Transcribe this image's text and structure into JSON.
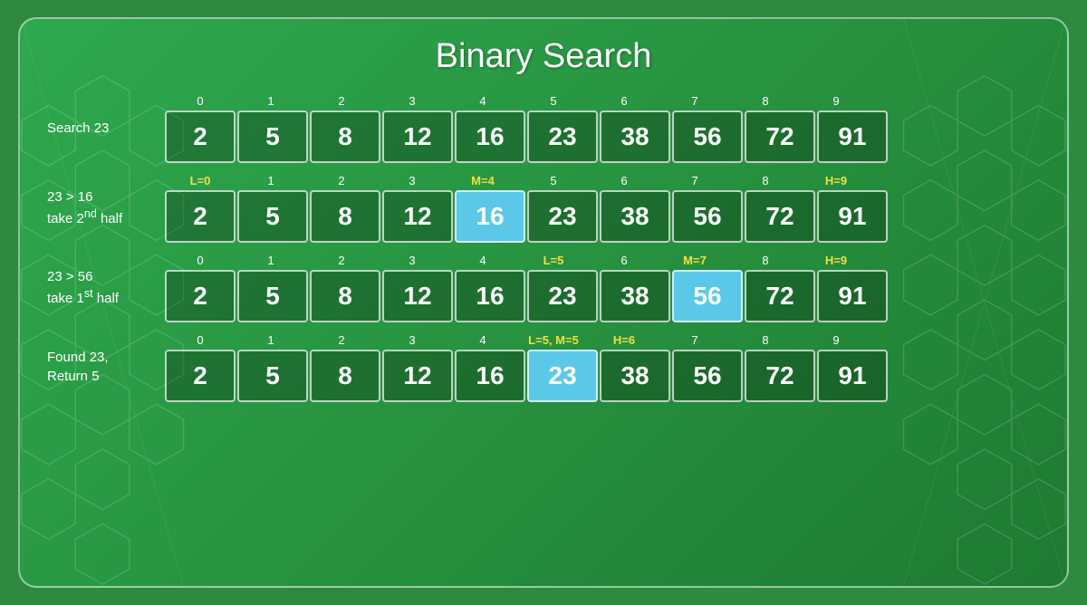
{
  "title": "Binary Search",
  "rows": [
    {
      "label": "Search 23",
      "indices": [
        {
          "val": "0",
          "style": "normal"
        },
        {
          "val": "1",
          "style": "normal"
        },
        {
          "val": "2",
          "style": "normal"
        },
        {
          "val": "3",
          "style": "normal"
        },
        {
          "val": "4",
          "style": "normal"
        },
        {
          "val": "5",
          "style": "normal"
        },
        {
          "val": "6",
          "style": "normal"
        },
        {
          "val": "7",
          "style": "normal"
        },
        {
          "val": "8",
          "style": "normal"
        },
        {
          "val": "9",
          "style": "normal"
        }
      ],
      "cells": [
        {
          "val": "2",
          "style": "normal"
        },
        {
          "val": "5",
          "style": "normal"
        },
        {
          "val": "8",
          "style": "normal"
        },
        {
          "val": "12",
          "style": "normal"
        },
        {
          "val": "16",
          "style": "normal"
        },
        {
          "val": "23",
          "style": "normal"
        },
        {
          "val": "38",
          "style": "normal"
        },
        {
          "val": "56",
          "style": "normal"
        },
        {
          "val": "72",
          "style": "normal"
        },
        {
          "val": "91",
          "style": "normal"
        }
      ]
    },
    {
      "label": "23 > 16\ntake 2nd half",
      "label2": "nd",
      "indices": [
        {
          "val": "L=0",
          "style": "yellow"
        },
        {
          "val": "1",
          "style": "normal"
        },
        {
          "val": "2",
          "style": "normal"
        },
        {
          "val": "3",
          "style": "normal"
        },
        {
          "val": "M=4",
          "style": "yellow"
        },
        {
          "val": "5",
          "style": "normal"
        },
        {
          "val": "6",
          "style": "normal"
        },
        {
          "val": "7",
          "style": "normal"
        },
        {
          "val": "8",
          "style": "normal"
        },
        {
          "val": "H=9",
          "style": "yellow"
        }
      ],
      "cells": [
        {
          "val": "2",
          "style": "normal"
        },
        {
          "val": "5",
          "style": "normal"
        },
        {
          "val": "8",
          "style": "normal"
        },
        {
          "val": "12",
          "style": "normal"
        },
        {
          "val": "16",
          "style": "highlighted"
        },
        {
          "val": "23",
          "style": "normal"
        },
        {
          "val": "38",
          "style": "normal"
        },
        {
          "val": "56",
          "style": "normal"
        },
        {
          "val": "72",
          "style": "normal"
        },
        {
          "val": "91",
          "style": "normal"
        }
      ]
    },
    {
      "label": "23 > 56\ntake 1st half",
      "indices": [
        {
          "val": "0",
          "style": "normal"
        },
        {
          "val": "1",
          "style": "normal"
        },
        {
          "val": "2",
          "style": "normal"
        },
        {
          "val": "3",
          "style": "normal"
        },
        {
          "val": "4",
          "style": "normal"
        },
        {
          "val": "L=5",
          "style": "yellow"
        },
        {
          "val": "6",
          "style": "normal"
        },
        {
          "val": "M=7",
          "style": "yellow"
        },
        {
          "val": "8",
          "style": "normal"
        },
        {
          "val": "H=9",
          "style": "yellow"
        }
      ],
      "cells": [
        {
          "val": "2",
          "style": "normal"
        },
        {
          "val": "5",
          "style": "normal"
        },
        {
          "val": "8",
          "style": "normal"
        },
        {
          "val": "12",
          "style": "normal"
        },
        {
          "val": "16",
          "style": "normal"
        },
        {
          "val": "23",
          "style": "normal"
        },
        {
          "val": "38",
          "style": "normal"
        },
        {
          "val": "56",
          "style": "highlighted"
        },
        {
          "val": "72",
          "style": "normal"
        },
        {
          "val": "91",
          "style": "normal"
        }
      ]
    },
    {
      "label": "Found 23,\nReturn 5",
      "indices": [
        {
          "val": "0",
          "style": "normal"
        },
        {
          "val": "1",
          "style": "normal"
        },
        {
          "val": "2",
          "style": "normal"
        },
        {
          "val": "3",
          "style": "normal"
        },
        {
          "val": "4",
          "style": "normal"
        },
        {
          "val": "L=5, M=5",
          "style": "yellow"
        },
        {
          "val": "H=6",
          "style": "yellow"
        },
        {
          "val": "7",
          "style": "normal"
        },
        {
          "val": "8",
          "style": "normal"
        },
        {
          "val": "9",
          "style": "normal"
        }
      ],
      "cells": [
        {
          "val": "2",
          "style": "normal"
        },
        {
          "val": "5",
          "style": "normal"
        },
        {
          "val": "8",
          "style": "normal"
        },
        {
          "val": "12",
          "style": "normal"
        },
        {
          "val": "16",
          "style": "normal"
        },
        {
          "val": "23",
          "style": "highlighted"
        },
        {
          "val": "38",
          "style": "normal"
        },
        {
          "val": "56",
          "style": "normal"
        },
        {
          "val": "72",
          "style": "normal"
        },
        {
          "val": "91",
          "style": "normal"
        }
      ]
    }
  ]
}
